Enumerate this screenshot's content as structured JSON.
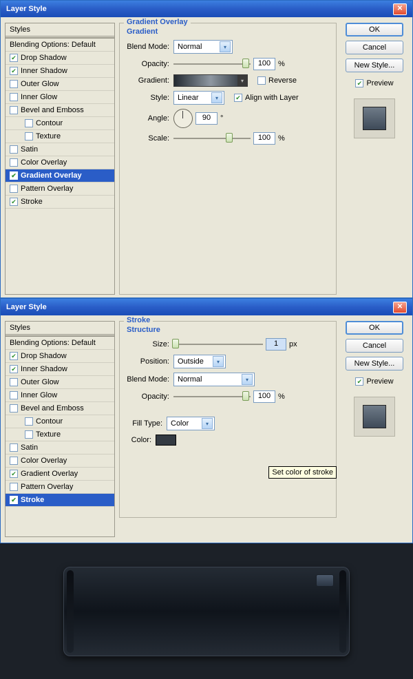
{
  "dialog_title": "Layer Style",
  "sidebar": {
    "header": "Styles",
    "blending_options": "Blending Options: Default",
    "items": {
      "drop_shadow": "Drop Shadow",
      "inner_shadow": "Inner Shadow",
      "outer_glow": "Outer Glow",
      "inner_glow": "Inner Glow",
      "bevel_emboss": "Bevel and Emboss",
      "contour": "Contour",
      "texture": "Texture",
      "satin": "Satin",
      "color_overlay": "Color Overlay",
      "gradient_overlay": "Gradient Overlay",
      "pattern_overlay": "Pattern Overlay",
      "stroke": "Stroke"
    }
  },
  "buttons": {
    "ok": "OK",
    "cancel": "Cancel",
    "new_style": "New Style...",
    "preview": "Preview"
  },
  "gradient_overlay": {
    "title": "Gradient Overlay",
    "subtitle": "Gradient",
    "blend_mode_label": "Blend Mode:",
    "blend_mode_value": "Normal",
    "opacity_label": "Opacity:",
    "opacity_value": "100",
    "pct": "%",
    "gradient_label": "Gradient:",
    "reverse": "Reverse",
    "style_label": "Style:",
    "style_value": "Linear",
    "align_layer": "Align with Layer",
    "angle_label": "Angle:",
    "angle_value": "90",
    "deg": "°",
    "scale_label": "Scale:",
    "scale_value": "100"
  },
  "stroke": {
    "title": "Stroke",
    "subtitle": "Structure",
    "size_label": "Size:",
    "size_value": "1",
    "px": "px",
    "position_label": "Position:",
    "position_value": "Outside",
    "blend_mode_label": "Blend Mode:",
    "blend_mode_value": "Normal",
    "opacity_label": "Opacity:",
    "opacity_value": "100",
    "pct": "%",
    "fill_type_label": "Fill Type:",
    "fill_type_value": "Color",
    "color_label": "Color:",
    "tooltip": "Set color of stroke"
  }
}
